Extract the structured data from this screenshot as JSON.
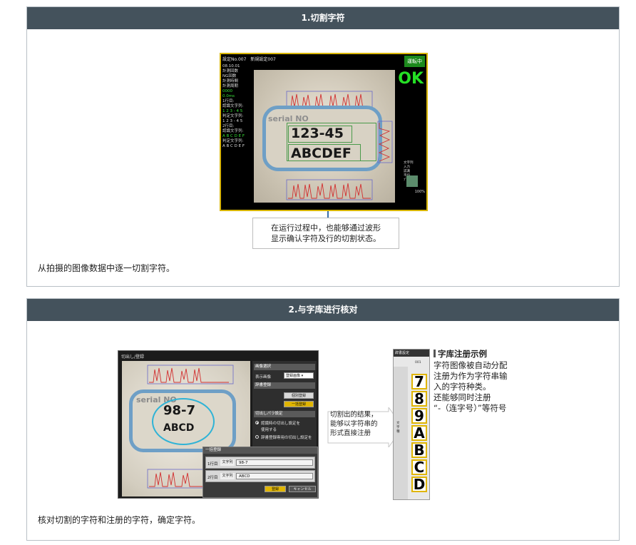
{
  "section1": {
    "header": "1.切割字符",
    "caption": "从拍摄的图像数据中逐一切割字符。",
    "callout": [
      "在运行过程中，也能够通过波形",
      "显示确认字符及行的切割状态。"
    ],
    "monitor": {
      "top_line": "設定No.007　新規設定007",
      "run_badge": "運転中",
      "ok_text": "OK",
      "line1": "123-45",
      "line2": "ABCDEF",
      "serial": "serial NO",
      "left_info": [
        "08.10.01",
        "計測回数",
        "NG回数",
        "計測時間",
        "計測周期",
        "0000",
        "0.0ms",
        "1行目:",
        "認識文字列:",
        "1 2 3 - 4 5",
        "判定文字列:",
        "1 2 3 - 4 5",
        "2行目:",
        "認識文字列:",
        "A B C D E F",
        "判定文字列:",
        "A B C D E F"
      ],
      "right_info": [
        "文字列",
        "入力",
        "認識",
        "平均",
        "ﾌﾟﾚ"
      ],
      "pct": "100%"
    }
  },
  "section2": {
    "header": "2.与字库进行核对",
    "caption": "核对切割的字符和注册的字符，确定字符。",
    "screen": {
      "title": "切出し/登録",
      "line1": "98-7",
      "line2": "ABCD",
      "serial": "serial NO",
      "panel": {
        "sec1": "画像選択",
        "display_label": "表示画像",
        "display_value": "登録画像",
        "sec2": "辞書登録",
        "btn_individual": "個別登録",
        "btn_batch": "一括登録",
        "sec3": "切出しパラ設定",
        "radio1": "認識時の切出し設定を",
        "radio1b": "使用する",
        "radio2": "辞書登録専用の切出し設定を"
      },
      "dialog": {
        "title": "一括登録",
        "rows": [
          {
            "label": "1行目",
            "key": "文字列",
            "value": "98-7"
          },
          {
            "label": "2行目",
            "key": "文字列",
            "value": "ABCD"
          }
        ],
        "ok": "登録",
        "cancel": "キャンセル"
      }
    },
    "arrow_text": [
      "切割出的结果，",
      "能够以字符串的",
      "形式直接注册"
    ],
    "registration": {
      "top": "辞書設定",
      "num": "001",
      "side_label": "文字種",
      "chars": [
        "7",
        "8",
        "9",
        "A",
        "B",
        "C",
        "D"
      ],
      "title": "字库注册示例",
      "desc": [
        "字符图像被自动分配",
        "注册为作为字符串输",
        "入的字符种类。",
        "还能够同时注册",
        "“-（连字号）”等符号"
      ]
    }
  }
}
